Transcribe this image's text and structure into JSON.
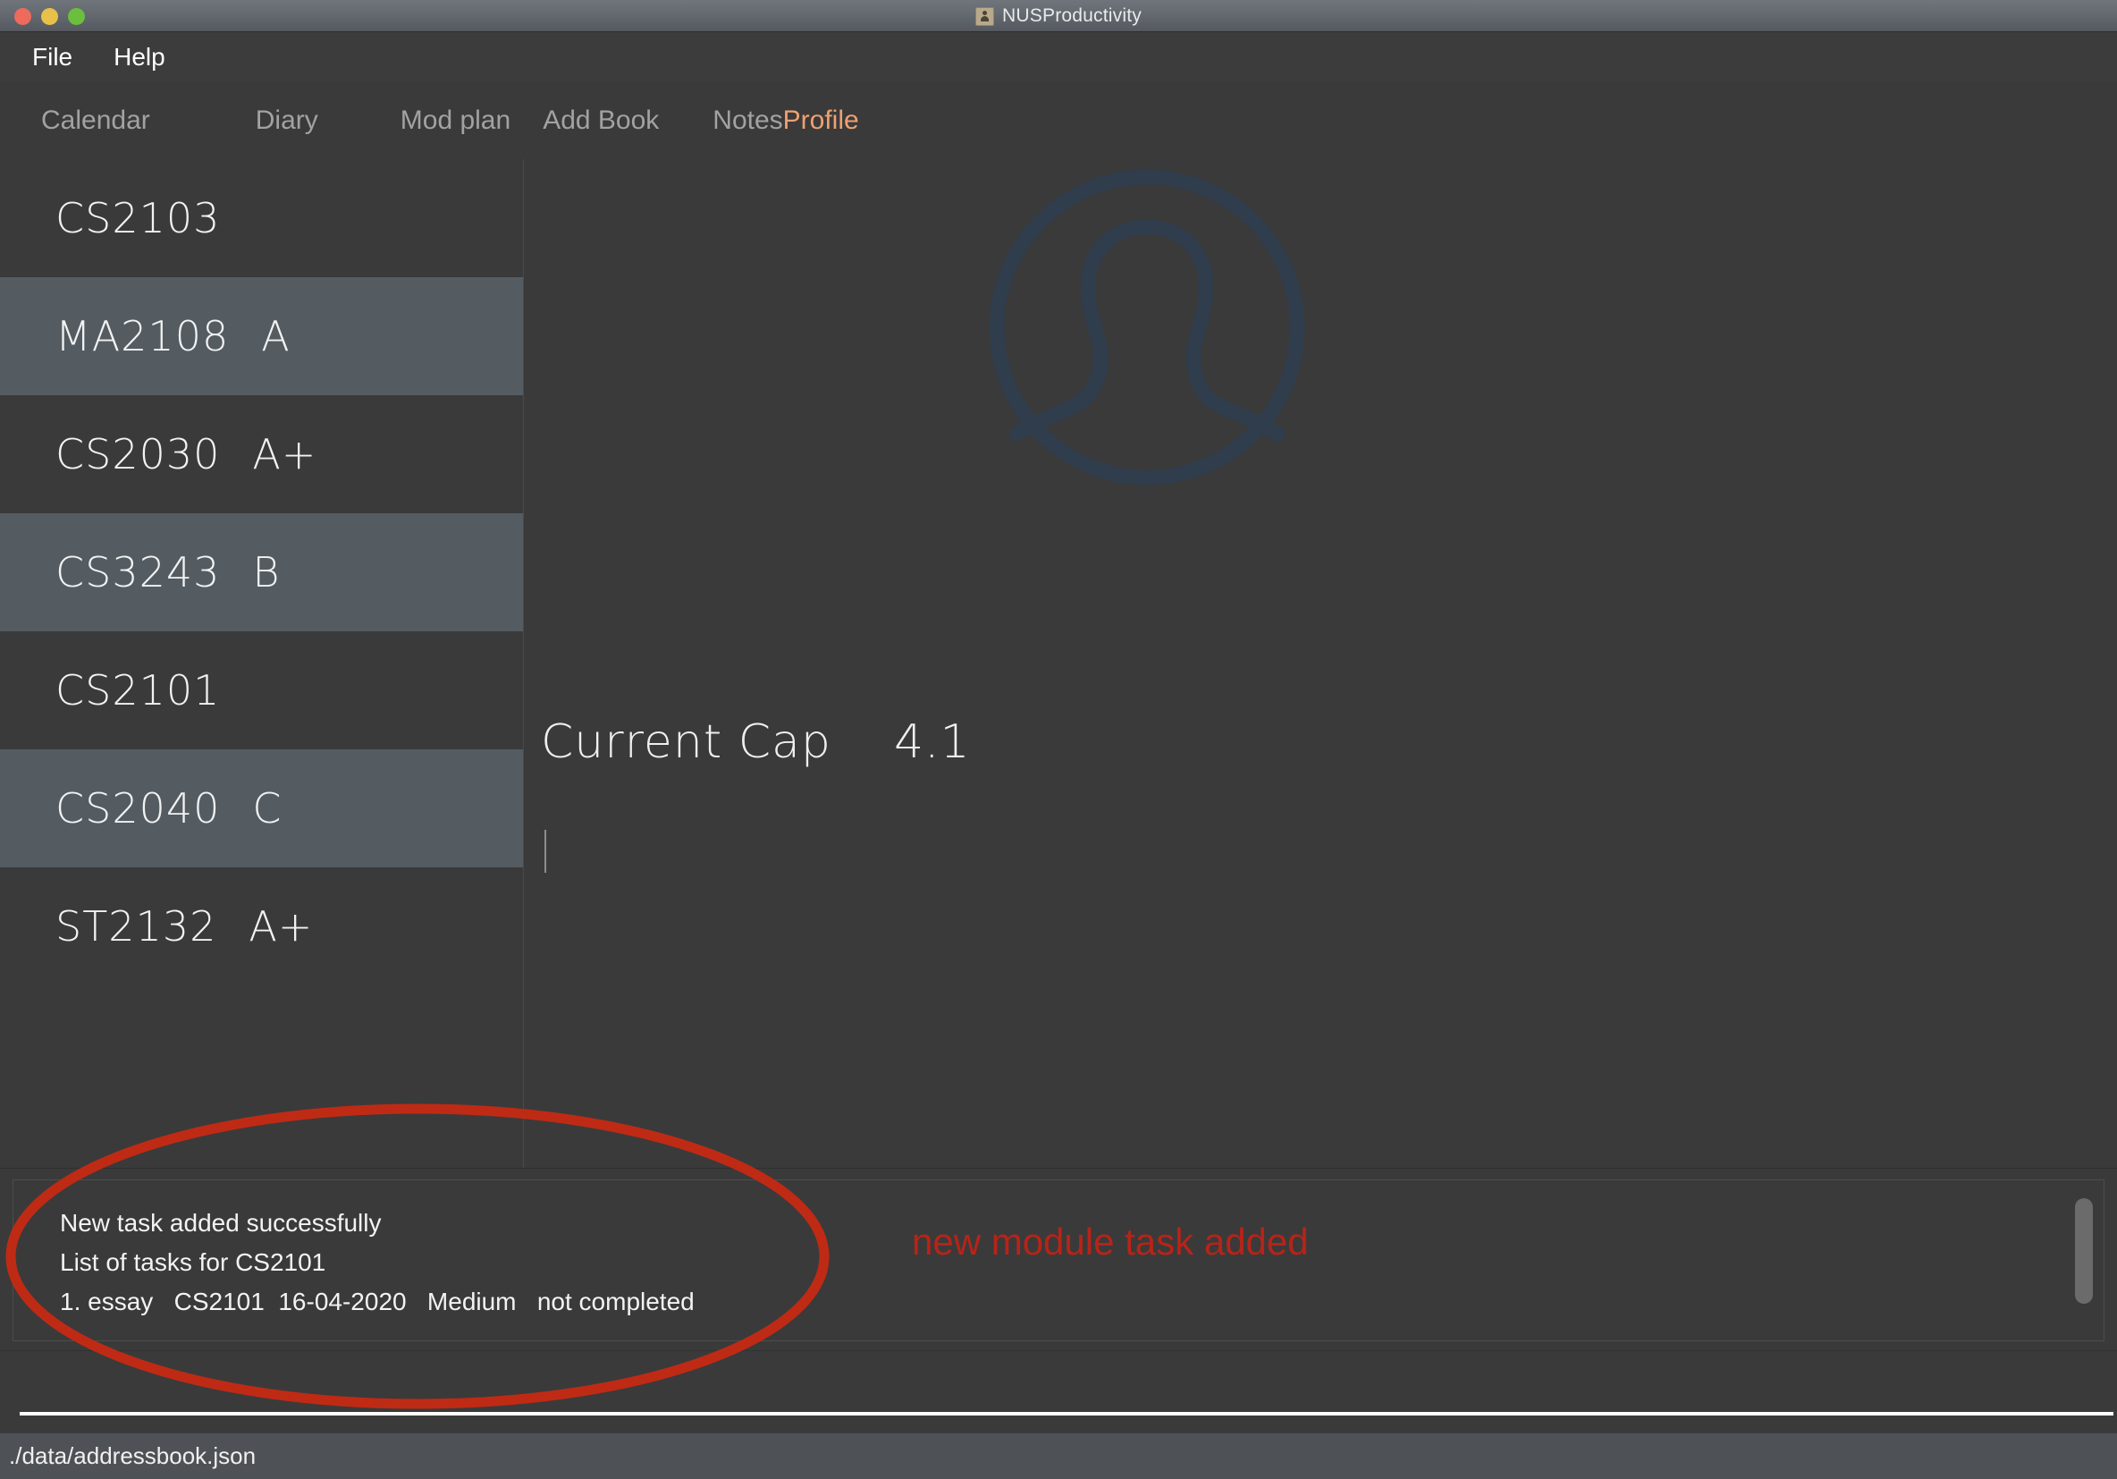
{
  "window": {
    "title": "NUSProductivity",
    "title_icon": "address-book-icon",
    "controls": {
      "close": "close",
      "minimize": "minimize",
      "zoom": "zoom"
    }
  },
  "menubar": {
    "items": [
      {
        "label": "File"
      },
      {
        "label": "Help"
      }
    ]
  },
  "tabs": [
    {
      "label": "Calendar",
      "active": false
    },
    {
      "label": "Diary",
      "active": false
    },
    {
      "label": "Mod plan",
      "active": false
    },
    {
      "label": "Add Book",
      "active": false
    },
    {
      "label": "Notes",
      "active": false
    },
    {
      "label": "Profile",
      "active": true
    }
  ],
  "sidebar": {
    "modules": [
      {
        "code": "CS2103",
        "grade": ""
      },
      {
        "code": "MA2108",
        "grade": "A"
      },
      {
        "code": "CS2030",
        "grade": "A+"
      },
      {
        "code": "CS3243",
        "grade": "B"
      },
      {
        "code": "CS2101",
        "grade": ""
      },
      {
        "code": "CS2040",
        "grade": "C"
      },
      {
        "code": "ST2132",
        "grade": "A+"
      }
    ]
  },
  "profile": {
    "avatar_icon": "person-avatar-icon",
    "cap_label": "Current Cap",
    "cap_value": "4.1"
  },
  "results": {
    "lines": [
      "New task added successfully",
      "List of tasks for CS2101",
      "1. essay   CS2101  16-04-2020   Medium   not completed"
    ]
  },
  "command": {
    "value": "",
    "placeholder": ""
  },
  "statusbar": {
    "file_path": "./data/addressbook.json"
  },
  "annotations": {
    "note_text": "new module task added",
    "ellipse_color": "#bf2a15",
    "note_color": "#b82318"
  },
  "colors": {
    "accent_orange": "#f0a070",
    "window_bg": "#3a3a3a",
    "row_highlight": "#545c62",
    "status_bg": "#4e5257",
    "avatar_stroke": "#303d4c"
  }
}
